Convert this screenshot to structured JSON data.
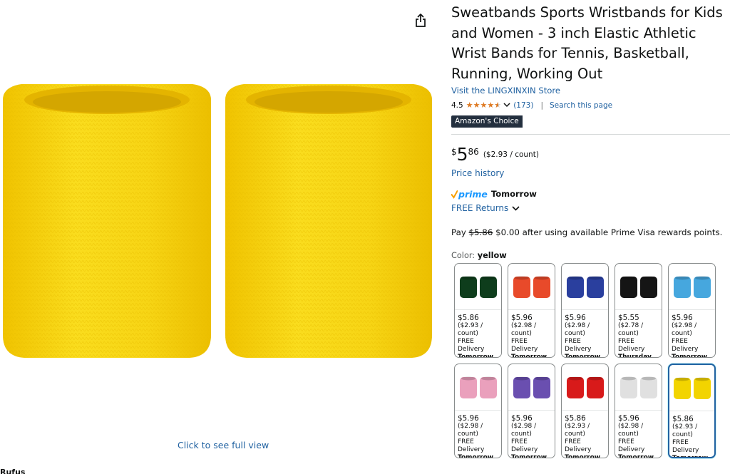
{
  "product": {
    "title": "Sweatbands Sports Wristbands for Kids and Women - 3 inch Elastic Athletic Wrist Bands for Tennis, Basketball, Running, Working Out",
    "store_link": "Visit the LINGXINXIN Store",
    "rating": "4.5",
    "rating_value": 4.5,
    "review_count": "(173)",
    "search_page": "Search this page",
    "badge": "Amazon's Choice",
    "price_symbol": "$",
    "price_whole": "5",
    "price_fraction": "86",
    "unit_price": "($2.93 / count)",
    "price_history": "Price history",
    "prime_word": "prime",
    "prime_delivery": "Tomorrow",
    "returns": "FREE Returns",
    "pay": {
      "prefix": "Pay",
      "old_price": "$5.86",
      "rest": "$0.00 after using available Prime Visa rewards points."
    },
    "color_label": "Color:",
    "color_value": "yellow"
  },
  "image": {
    "full_view": "Click to see full view",
    "rufus": "Rufus"
  },
  "swatches": [
    {
      "color": "#0e3d1c",
      "price": "$5.86",
      "unit": "($2.93 /",
      "count": "count)",
      "delivery": "FREE Delivery",
      "day": "Tomorrow",
      "selected": false
    },
    {
      "color": "#e84a2a",
      "price": "$5.96",
      "unit": "($2.98 /",
      "count": "count)",
      "delivery": "FREE Delivery",
      "day": "Tomorrow",
      "selected": false
    },
    {
      "color": "#2a3f9e",
      "price": "$5.96",
      "unit": "($2.98 /",
      "count": "count)",
      "delivery": "FREE Delivery",
      "day": "Tomorrow",
      "selected": false
    },
    {
      "color": "#151515",
      "price": "$5.55",
      "unit": "($2.78 /",
      "count": "count)",
      "delivery": "FREE Delivery",
      "day": "Thursday",
      "selected": false
    },
    {
      "color": "#46a7de",
      "price": "$5.96",
      "unit": "($2.98 /",
      "count": "count)",
      "delivery": "FREE Delivery",
      "day": "Tomorrow",
      "selected": false
    },
    {
      "color": "#eaa0bc",
      "price": "$5.96",
      "unit": "($2.98 /",
      "count": "count)",
      "delivery": "FREE Delivery",
      "day": "Tomorrow",
      "selected": false
    },
    {
      "color": "#6a4fb0",
      "price": "$5.96",
      "unit": "($2.98 /",
      "count": "count)",
      "delivery": "FREE Delivery",
      "day": "Tomorrow",
      "selected": false
    },
    {
      "color": "#d81a1a",
      "price": "$5.86",
      "unit": "($2.93 /",
      "count": "count)",
      "delivery": "FREE Delivery",
      "day": "Tomorrow",
      "selected": false
    },
    {
      "color": "#e0e0e0",
      "price": "$5.96",
      "unit": "($2.98 /",
      "count": "count)",
      "delivery": "FREE Delivery",
      "day": "Tomorrow",
      "selected": false
    },
    {
      "color": "#f2d400",
      "price": "$5.86",
      "unit": "($2.93 /",
      "count": "count)",
      "delivery": "FREE Delivery",
      "day": "Tomorrow",
      "selected": true
    }
  ],
  "colors": {
    "link": "#2162a1",
    "star": "#de7921",
    "prime": "#1a98ff",
    "badge_bg": "#232f3e",
    "band_yellow": "#f7d51a"
  },
  "icons": {
    "share": "share-icon",
    "chevron": "chevron-down-icon",
    "prime_check": "prime-check-icon"
  }
}
